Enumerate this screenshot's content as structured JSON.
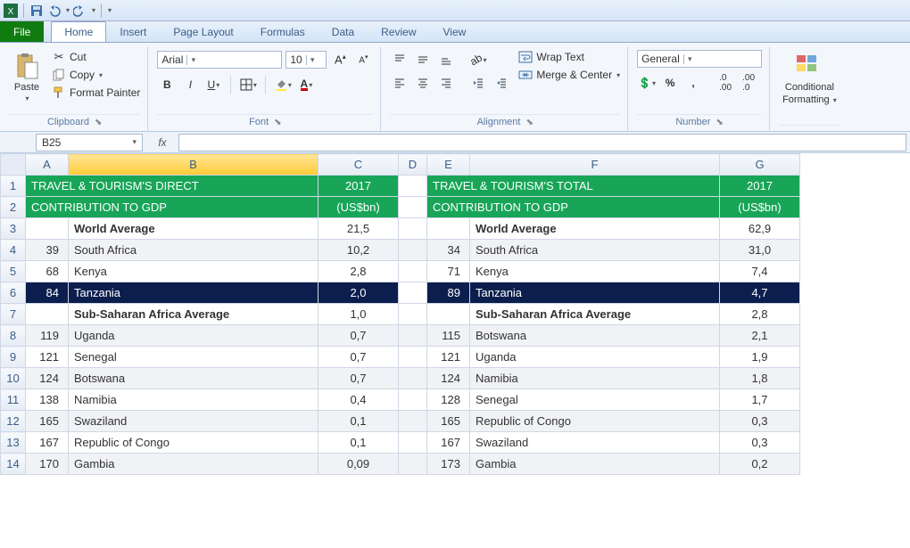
{
  "titlebar": {
    "tooltip": "Excel"
  },
  "tabs": {
    "file": "File",
    "items": [
      "Home",
      "Insert",
      "Page Layout",
      "Formulas",
      "Data",
      "Review",
      "View"
    ],
    "active": 0
  },
  "ribbon": {
    "clipboard": {
      "title": "Clipboard",
      "paste": "Paste",
      "cut": "Cut",
      "copy": "Copy",
      "painter": "Format Painter"
    },
    "font": {
      "title": "Font",
      "name": "Arial",
      "size": "10",
      "bold": "B",
      "italic": "I",
      "underline": "U"
    },
    "alignment": {
      "title": "Alignment",
      "wrap": "Wrap Text",
      "merge": "Merge & Center"
    },
    "number": {
      "title": "Number",
      "format": "General"
    },
    "styles": {
      "title": "",
      "cond": "Conditional",
      "cond2": "Formatting"
    }
  },
  "fbar": {
    "name": "B25",
    "fx": "fx",
    "formula": ""
  },
  "columns": [
    "A",
    "B",
    "C",
    "D",
    "E",
    "F",
    "G"
  ],
  "rowNums": [
    "1",
    "2",
    "3",
    "4",
    "5",
    "6",
    "7",
    "8",
    "9",
    "10",
    "11",
    "12",
    "13",
    "14"
  ],
  "data": {
    "left": {
      "title1": "TRAVEL & TOURISM'S DIRECT",
      "title2": "CONTRIBUTION TO GDP",
      "year": "2017",
      "unit": "(US$bn)",
      "rows": [
        {
          "rank": "",
          "name": "World Average",
          "val": "21,5",
          "bold": true
        },
        {
          "rank": "39",
          "name": "South Africa",
          "val": "10,2"
        },
        {
          "rank": "68",
          "name": "Kenya",
          "val": "2,8"
        },
        {
          "rank": "84",
          "name": "Tanzania",
          "val": "2,0",
          "dark": true
        },
        {
          "rank": "",
          "name": "Sub-Saharan Africa Average",
          "val": "1,0",
          "bold": true
        },
        {
          "rank": "119",
          "name": "Uganda",
          "val": "0,7"
        },
        {
          "rank": "121",
          "name": "Senegal",
          "val": "0,7"
        },
        {
          "rank": "124",
          "name": "Botswana",
          "val": "0,7"
        },
        {
          "rank": "138",
          "name": "Namibia",
          "val": "0,4"
        },
        {
          "rank": "165",
          "name": "Swaziland",
          "val": "0,1"
        },
        {
          "rank": "167",
          "name": "Republic of Congo",
          "val": "0,1"
        },
        {
          "rank": "170",
          "name": "Gambia",
          "val": "0,09"
        }
      ]
    },
    "right": {
      "title1": "TRAVEL & TOURISM'S TOTAL",
      "title2": "CONTRIBUTION TO GDP",
      "year": "2017",
      "unit": "(US$bn)",
      "rows": [
        {
          "rank": "",
          "name": "World Average",
          "val": "62,9",
          "bold": true
        },
        {
          "rank": "34",
          "name": "South Africa",
          "val": "31,0"
        },
        {
          "rank": "71",
          "name": "Kenya",
          "val": "7,4"
        },
        {
          "rank": "89",
          "name": "Tanzania",
          "val": "4,7",
          "dark": true
        },
        {
          "rank": "",
          "name": "Sub-Saharan Africa Average",
          "val": "2,8",
          "bold": true
        },
        {
          "rank": "115",
          "name": "Botswana",
          "val": "2,1"
        },
        {
          "rank": "121",
          "name": "Uganda",
          "val": "1,9"
        },
        {
          "rank": "124",
          "name": "Namibia",
          "val": "1,8"
        },
        {
          "rank": "128",
          "name": "Senegal",
          "val": "1,7"
        },
        {
          "rank": "165",
          "name": "Republic of Congo",
          "val": "0,3"
        },
        {
          "rank": "167",
          "name": "Swaziland",
          "val": "0,3"
        },
        {
          "rank": "173",
          "name": "Gambia",
          "val": "0,2"
        }
      ]
    }
  }
}
